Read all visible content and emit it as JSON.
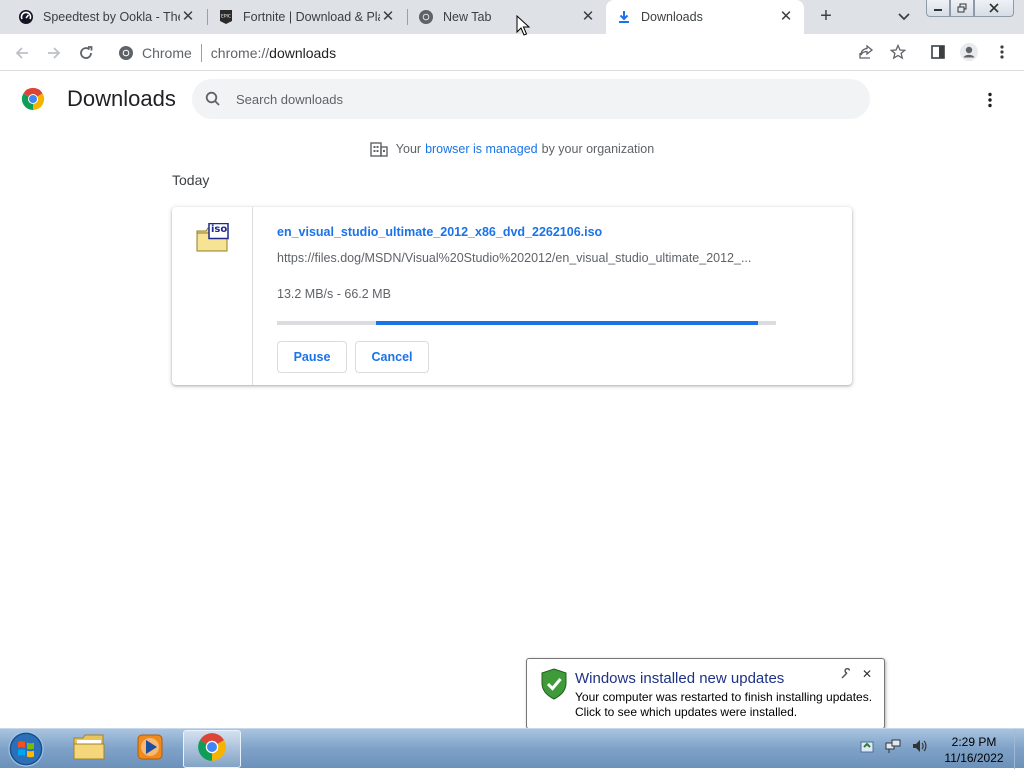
{
  "tabs": [
    {
      "title": "Speedtest by Ookla - The",
      "favicon": "speedtest-icon"
    },
    {
      "title": "Fortnite | Download & Pla",
      "favicon": "epic-games-icon"
    },
    {
      "title": "New Tab",
      "favicon": "chrome-icon"
    },
    {
      "title": "Downloads",
      "favicon": "download-icon"
    }
  ],
  "new_tab_glyph": "+",
  "toolbar": {
    "chip_label": "Chrome",
    "url_scheme": "chrome://",
    "url_host": "downloads"
  },
  "downloads_page": {
    "title": "Downloads",
    "search_placeholder": "Search downloads",
    "managed_prefix": "Your",
    "managed_link": "browser is managed",
    "managed_suffix": "by your organization",
    "date_heading": "Today"
  },
  "download_item": {
    "file_name": "en_visual_studio_ultimate_2012_x86_dvd_2262106.iso",
    "file_badge": "iso",
    "url": "https://files.dog/MSDN/Visual%20Studio%202012/en_visual_studio_ultimate_2012_...",
    "status": "13.2 MB/s - 66.2 MB",
    "progress_start": 0.198,
    "progress_end": 0.964,
    "pause_label": "Pause",
    "cancel_label": "Cancel"
  },
  "notification": {
    "title": "Windows installed new updates",
    "line1": "Your computer was restarted to finish installing updates.",
    "line2": "Click to see which updates were installed."
  },
  "taskbar": {
    "time": "2:29 PM",
    "date": "11/16/2022",
    "items": [
      "windows-explorer",
      "windows-media-player",
      "google-chrome"
    ]
  },
  "colors": {
    "accent": "#1a73e8",
    "tabstrip": "#dee1e6",
    "notification_title": "#1e3287"
  }
}
